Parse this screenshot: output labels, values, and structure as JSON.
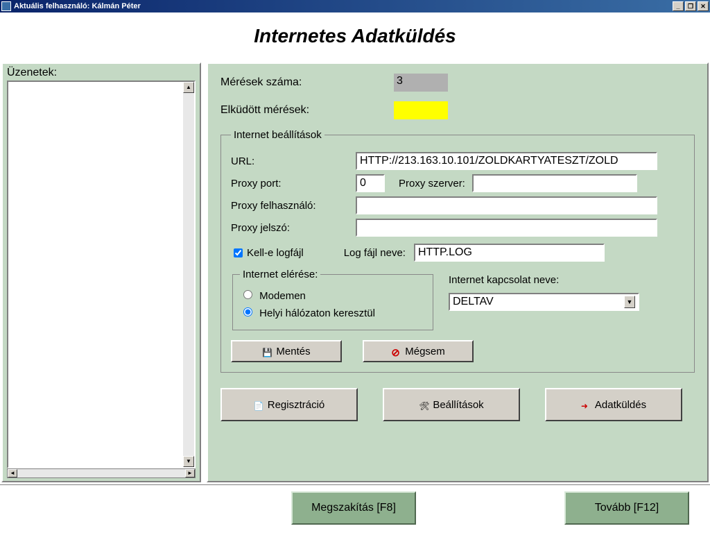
{
  "window": {
    "title": "Aktuális felhasználó: Kálmán Péter"
  },
  "page": {
    "title": "Internetes Adatküldés"
  },
  "left": {
    "messages_label": "Üzenetek:"
  },
  "info": {
    "count_label": "Mérések száma:",
    "count_value": "3",
    "sent_label": "Elküdött mérések:",
    "sent_value": ""
  },
  "settings": {
    "legend": "Internet beállítások",
    "url_label": "URL:",
    "url_value": "HTTP://213.163.10.101/ZOLDKARTYATESZT/ZOLD",
    "proxy_port_label": "Proxy port:",
    "proxy_port_value": "0",
    "proxy_server_label": "Proxy szerver:",
    "proxy_server_value": "",
    "proxy_user_label": "Proxy felhasználó:",
    "proxy_user_value": "",
    "proxy_pass_label": "Proxy jelszó:",
    "proxy_pass_value": "",
    "log_check_label": "Kell-e logfájl",
    "log_check_value": true,
    "log_name_label": "Log fájl neve:",
    "log_name_value": "HTTP.LOG",
    "access_legend": "Internet elérése:",
    "access_modem": "Modemen",
    "access_lan": "Helyi hálózaton keresztül",
    "access_selected": "lan",
    "conn_label": "Internet kapcsolat neve:",
    "conn_value": "DELTAV",
    "save_label": "Mentés",
    "cancel_label": "Mégsem"
  },
  "buttons": {
    "register": "Regisztráció",
    "settings": "Beállítások",
    "send": "Adatküldés"
  },
  "bottom": {
    "abort": "Megszakítás [F8]",
    "next": "Tovább [F12]"
  }
}
